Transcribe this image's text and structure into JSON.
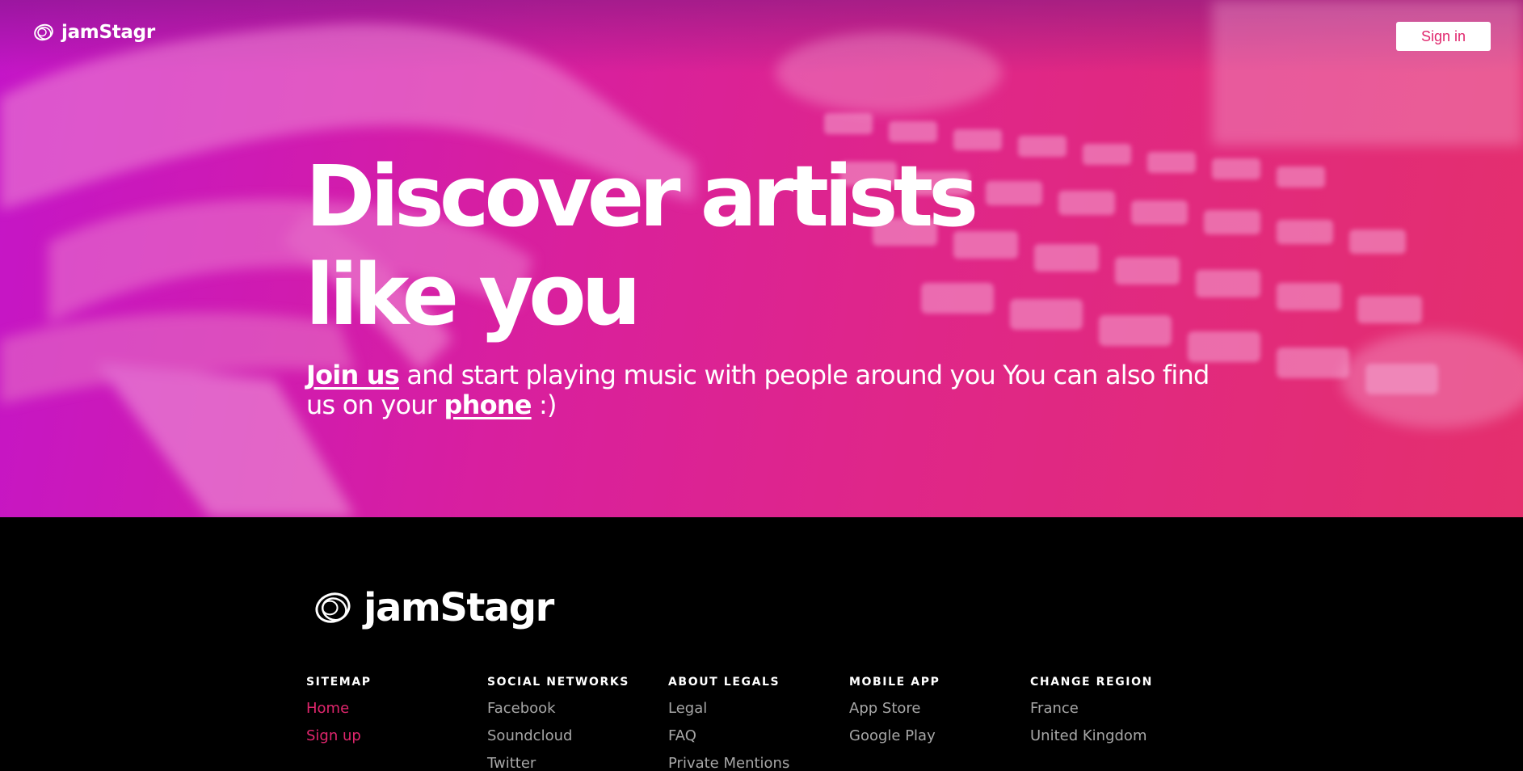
{
  "header": {
    "brand": "jamStagr",
    "signin_label": "Sign in"
  },
  "hero": {
    "title_line1": "Discover artists",
    "title_line2": "like you",
    "join_link": "Join us",
    "sub_text1": " and start playing music with people around you You can also find us on your ",
    "phone_link": "phone",
    "sub_text2": " :)"
  },
  "footer": {
    "brand": "jamStagr",
    "columns": [
      {
        "heading": "SITEMAP",
        "links": [
          "Home",
          "Sign up"
        ]
      },
      {
        "heading": "SOCIAL NETWORKS",
        "links": [
          "Facebook",
          "Soundcloud",
          "Twitter"
        ]
      },
      {
        "heading": "ABOUT LEGALS",
        "links": [
          "Legal",
          "FAQ",
          "Private Mentions"
        ]
      },
      {
        "heading": "MOBILE APP",
        "links": [
          "App Store",
          "Google Play"
        ]
      },
      {
        "heading": "CHANGE REGION",
        "links": [
          "France",
          "United Kingdom"
        ]
      }
    ]
  },
  "colors": {
    "accent": "#e0266d",
    "hero_start": "#c415c8",
    "hero_end": "#e42f6d",
    "footer_bg": "#000000",
    "footer_link": "#a7a7a7"
  },
  "icons": {
    "brand_logo": "scribble-circles-logo-icon"
  }
}
